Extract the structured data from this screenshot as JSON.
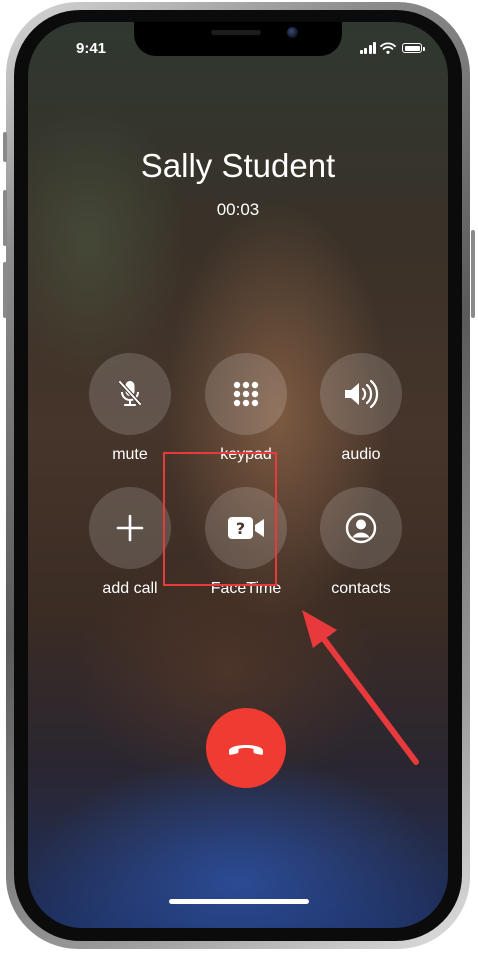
{
  "status_bar": {
    "time": "9:41"
  },
  "call": {
    "caller_name": "Sally Student",
    "duration": "00:03"
  },
  "controls": {
    "mute": {
      "label": "mute",
      "icon": "mic-slash-icon"
    },
    "keypad": {
      "label": "keypad",
      "icon": "keypad-grid-icon"
    },
    "audio": {
      "label": "audio",
      "icon": "speaker-icon"
    },
    "add_call": {
      "label": "add call",
      "icon": "plus-icon"
    },
    "facetime": {
      "label": "FaceTime",
      "icon": "facetime-unavailable-icon"
    },
    "contacts": {
      "label": "contacts",
      "icon": "contact-person-icon"
    }
  },
  "end_call": {
    "icon": "phone-hangup-icon",
    "color": "#ef3b32"
  },
  "annotation": {
    "highlight_color": "#e8393d",
    "target": "facetime-button"
  }
}
